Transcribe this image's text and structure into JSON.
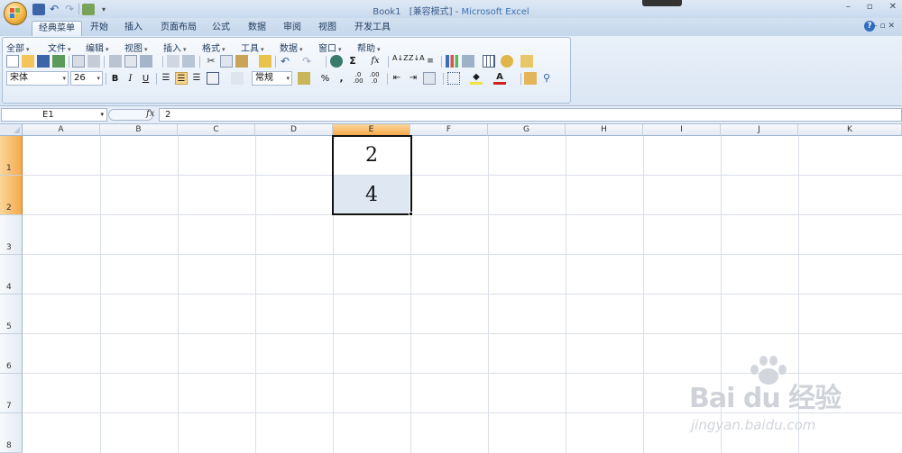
{
  "window": {
    "title_doc": "Book1",
    "title_mode": "[兼容模式]",
    "title_sep": " - ",
    "title_app": "Microsoft Excel",
    "minimize": "–",
    "restore": "▫",
    "close": "✕"
  },
  "tabs": [
    "经典菜单",
    "开始",
    "插入",
    "页面布局",
    "公式",
    "数据",
    "审阅",
    "视图",
    "开发工具"
  ],
  "menus": [
    "全部",
    "文件",
    "编辑",
    "视图",
    "插入",
    "格式",
    "工具",
    "数据",
    "窗口",
    "帮助"
  ],
  "toolbar": {
    "font_name": "宋体",
    "font_size": "26",
    "bold": "B",
    "italic": "I",
    "underline": "U",
    "number_format": "常规",
    "percent": "%",
    "comma": ",",
    "sigma": "Σ",
    "fx": "fx"
  },
  "formula_bar": {
    "name_box": "E1",
    "fx_label": "fx",
    "formula": "2"
  },
  "sheet": {
    "columns": [
      "A",
      "B",
      "C",
      "D",
      "E",
      "F",
      "G",
      "H",
      "I",
      "J",
      "K"
    ],
    "rows": [
      "1",
      "2",
      "3",
      "4",
      "5",
      "6",
      "7",
      "8"
    ],
    "selected_column": "E",
    "selected_rows": [
      "1",
      "2"
    ],
    "cells": {
      "E1": "2",
      "E2": "4"
    }
  },
  "watermark": {
    "brand": "Bai du 经验",
    "sub": "jingyan.baidu.com"
  },
  "colors": {
    "selected_header": "#f5a94c",
    "ribbon_bg": "#dbe6f4",
    "title_text": "#3d6fb5"
  }
}
